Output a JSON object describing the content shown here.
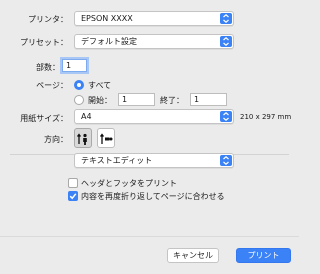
{
  "printer": {
    "label": "プリンタ：",
    "value": "EPSON XXXX"
  },
  "preset": {
    "label": "プリセット：",
    "value": "デフォルト設定"
  },
  "copies": {
    "label": "部数：",
    "value": "1"
  },
  "pages": {
    "label": "ページ：",
    "all_label": "すべて",
    "from_label": "開始：",
    "from_value": "1",
    "to_label": "終了：",
    "to_value": "1"
  },
  "paper_size": {
    "label": "用紙サイズ：",
    "value": "A4",
    "dimensions": "210 x 297 mm"
  },
  "orientation": {
    "label": "方向：",
    "selected": "portrait"
  },
  "section_menu": {
    "value": "テキストエディット"
  },
  "options": {
    "header_footer_label": "ヘッダとフッタをプリント",
    "header_footer_checked": false,
    "rewrap_label": "内容を再度折り返してページに合わせる",
    "rewrap_checked": true
  },
  "buttons": {
    "cancel": "キャンセル",
    "print": "プリント"
  },
  "colors": {
    "accent": "#3b82f6",
    "background": "#ebebeb"
  }
}
